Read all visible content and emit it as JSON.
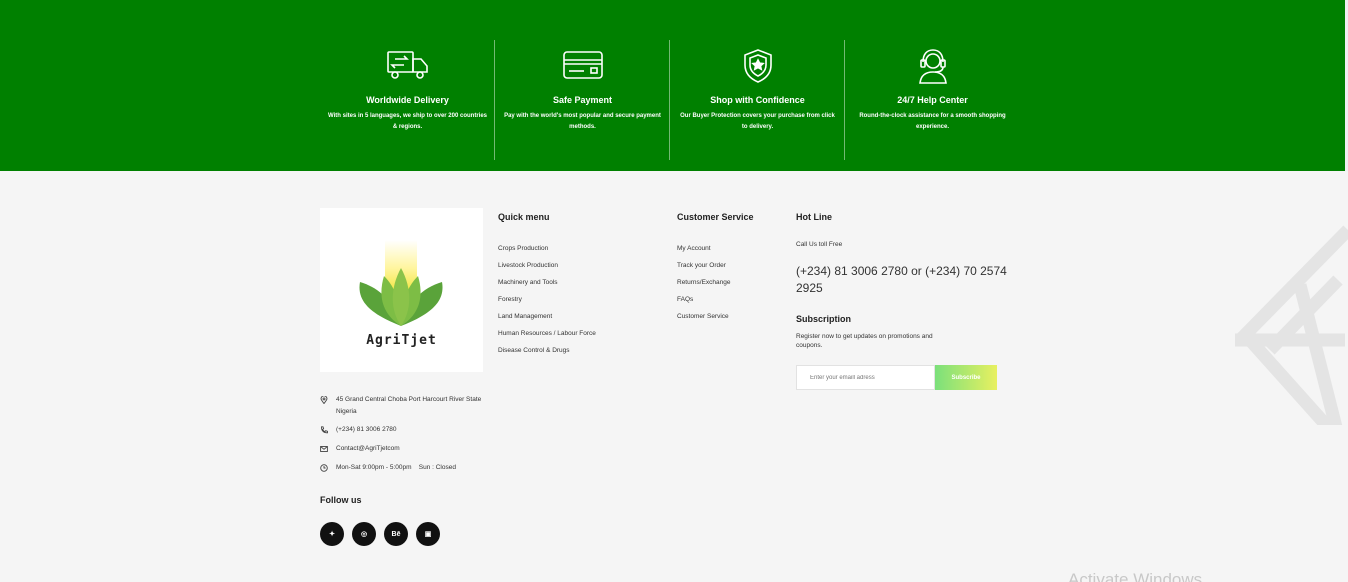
{
  "features": [
    {
      "icon": "truck-icon",
      "title": "Worldwide Delivery",
      "desc": "With sites in 5 languages, we ship to over 200 countries & regions."
    },
    {
      "icon": "credit-card-icon",
      "title": "Safe Payment",
      "desc": "Pay with the world's most popular and secure payment methods."
    },
    {
      "icon": "shield-star-icon",
      "title": "Shop with Confidence",
      "desc": "Our Buyer Protection covers your purchase from click to delivery."
    },
    {
      "icon": "headset-icon",
      "title": "24/7 Help Center",
      "desc": "Round-the-clock assistance for a smooth shopping experience."
    }
  ],
  "brand": {
    "logo_text": "AgriTjet"
  },
  "contact": {
    "address": "45 Grand Central Choba Port Harcourt River State Nigeria",
    "phone": "(+234) 81 3006 2780",
    "email": "Contact@AgriTjetcom",
    "hours": "Mon-Sat 9:00pm - 5:00pm    Sun : Closed"
  },
  "follow": {
    "title": "Follow us",
    "networks": [
      {
        "icon": "twitter-icon",
        "glyph": "✦"
      },
      {
        "icon": "dribbble-icon",
        "glyph": "◎"
      },
      {
        "icon": "behance-icon",
        "glyph": "Bē"
      },
      {
        "icon": "instagram-icon",
        "glyph": "▣"
      }
    ]
  },
  "quick_menu": {
    "title": "Quick menu",
    "items": [
      "Crops Production",
      "Livestock Production",
      "Machinery and Tools",
      "Forestry",
      "Land Management",
      "Human Resources / Labour Force",
      "Disease Control & Drugs"
    ]
  },
  "customer_service": {
    "title": "Customer Service",
    "items": [
      "My Account",
      "Track your Order",
      "Returns/Exchange",
      "FAQs",
      "Customer Service"
    ]
  },
  "hotline": {
    "title": "Hot Line",
    "subtitle": "Call Us toll Free",
    "phones": "(+234) 81 3006 2780 or (+234) 70 2574 2925"
  },
  "subscription": {
    "title": "Subscription",
    "desc": "Register now to get updates on promotions and coupons.",
    "placeholder": "Enter your emaill adress",
    "button": "Subscribe"
  },
  "watermark": "Activate Windows",
  "colors": {
    "band": "#008000",
    "background": "#f5f5f5",
    "social": "#111111"
  }
}
